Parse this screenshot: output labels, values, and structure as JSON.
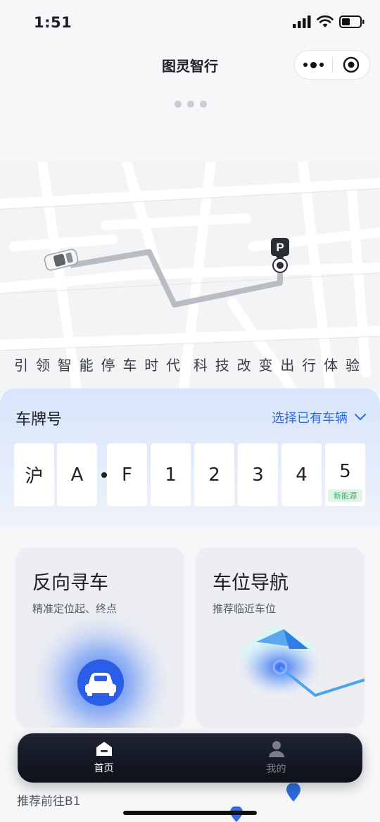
{
  "status_bar": {
    "time": "1:51"
  },
  "nav": {
    "title": "图灵智行",
    "more_icon": "more-dots-icon",
    "close_icon": "target-close-icon"
  },
  "hero": {
    "slogan_left": [
      "引",
      "领",
      "智",
      "能",
      "停",
      "车",
      "时",
      "代"
    ],
    "slogan_right": [
      "科",
      "技",
      "改",
      "变",
      "出",
      "行",
      "体",
      "验"
    ],
    "parking_marker": "P"
  },
  "plate": {
    "label": "车牌号",
    "select_label": "选择已有车辆",
    "chars": [
      "沪",
      "A",
      "F",
      "1",
      "2",
      "3",
      "4",
      "5"
    ],
    "ev_badge": "新能源"
  },
  "features": [
    {
      "title": "反向寻车",
      "subtitle": "精准定位起、终点"
    },
    {
      "title": "车位导航",
      "subtitle": "推荐临近车位"
    }
  ],
  "recommend": {
    "text": "推荐前往B1"
  },
  "tabs": [
    {
      "label": "首页",
      "icon": "home-icon",
      "active": true
    },
    {
      "label": "我的",
      "icon": "user-icon",
      "active": false
    }
  ],
  "colors": {
    "accent": "#2f6ce0",
    "tabbar": "#141925",
    "ev_green": "#3bb26a"
  }
}
